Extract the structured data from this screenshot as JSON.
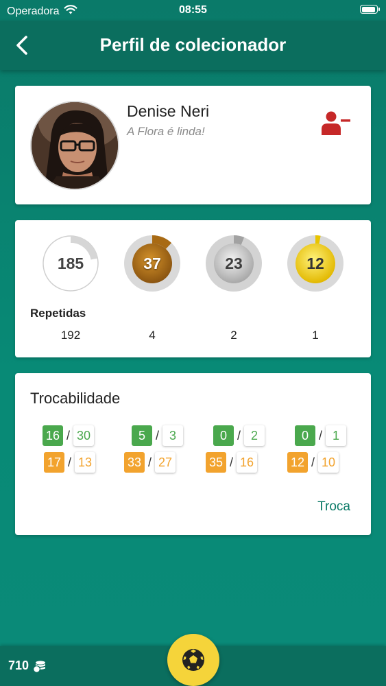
{
  "status_bar": {
    "carrier": "Operadora",
    "time": "08:55"
  },
  "nav": {
    "title": "Perfil de colecionador",
    "back_icon": "chevron-left-icon"
  },
  "profile": {
    "name": "Denise Neri",
    "motto": "A Flora é linda!",
    "remove_icon": "user-minus-icon",
    "colors": {
      "remove": "#c62828"
    }
  },
  "stats": {
    "rings": [
      {
        "value": "185",
        "tier": "plain",
        "progress": 0.22
      },
      {
        "value": "37",
        "tier": "bronze",
        "progress": 0.12
      },
      {
        "value": "23",
        "tier": "silver",
        "progress": 0.06
      },
      {
        "value": "12",
        "tier": "gold",
        "progress": 0.03
      }
    ],
    "repetidas_label": "Repetidas",
    "repetidas": [
      "192",
      "4",
      "2",
      "1"
    ]
  },
  "trade": {
    "title": "Trocabilidade",
    "columns": [
      {
        "green": [
          "16",
          "30"
        ],
        "orange": [
          "17",
          "13"
        ]
      },
      {
        "green": [
          "5",
          "3"
        ],
        "orange": [
          "33",
          "27"
        ]
      },
      {
        "green": [
          "0",
          "2"
        ],
        "orange": [
          "35",
          "16"
        ]
      },
      {
        "green": [
          "0",
          "1"
        ],
        "orange": [
          "12",
          "10"
        ]
      }
    ],
    "separator": "/",
    "link": "Troca",
    "colors": {
      "green": "#4aa84d",
      "orange": "#f2a32e"
    }
  },
  "bottom": {
    "coins": "710",
    "coins_icon": "coins-icon",
    "fab_icon": "soccer-ball-icon"
  }
}
